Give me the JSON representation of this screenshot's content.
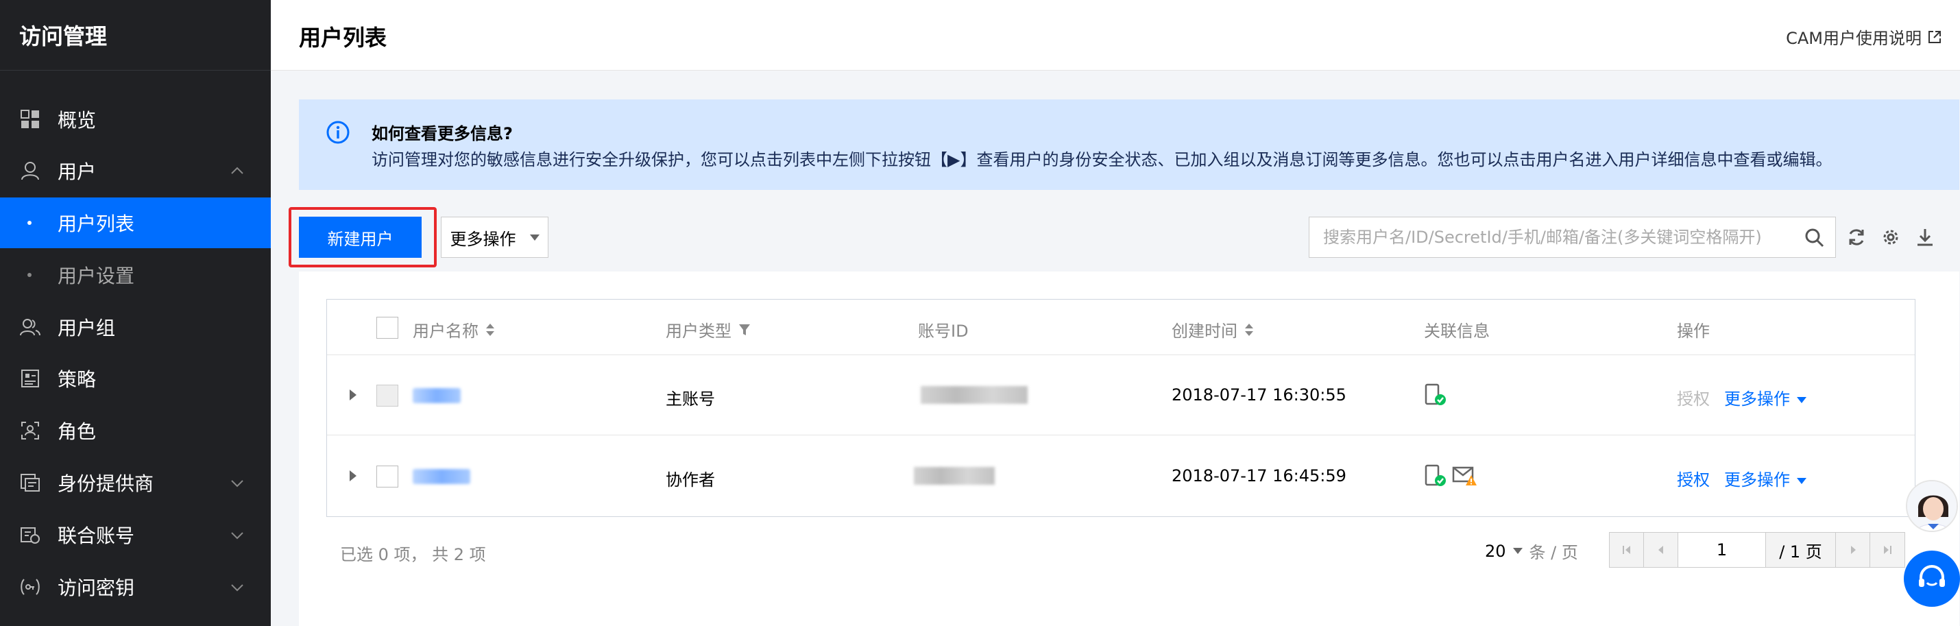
{
  "sidebar": {
    "title": "访问管理",
    "items": [
      {
        "label": "概览",
        "icon": "grid-icon"
      },
      {
        "label": "用户",
        "icon": "user-icon",
        "expanded": true
      },
      {
        "label": "用户列表",
        "active": true
      },
      {
        "label": "用户设置"
      },
      {
        "label": "用户组",
        "icon": "user-group-icon"
      },
      {
        "label": "策略",
        "icon": "policy-icon"
      },
      {
        "label": "角色",
        "icon": "role-icon"
      },
      {
        "label": "身份提供商",
        "icon": "identity-provider-icon"
      },
      {
        "label": "联合账号",
        "icon": "federated-account-icon"
      },
      {
        "label": "访问密钥",
        "icon": "access-key-icon"
      }
    ]
  },
  "header": {
    "title": "用户列表",
    "doc_link": "CAM用户使用说明"
  },
  "banner": {
    "title": "如何查看更多信息?",
    "text": "访问管理对您的敏感信息进行安全升级保护，您可以点击列表中左侧下拉按钮【▶】查看用户的身份安全状态、已加入组以及消息订阅等更多信息。您也可以点击用户名进入用户详细信息中查看或编辑。"
  },
  "toolbar": {
    "new_user": "新建用户",
    "more_actions": "更多操作",
    "search_placeholder": "搜索用户名/ID/SecretId/手机/邮箱/备注(多关键词空格隔开)"
  },
  "table": {
    "columns": [
      "用户名称",
      "用户类型",
      "账号ID",
      "创建时间",
      "关联信息",
      "操作"
    ],
    "rows": [
      {
        "type": "主账号",
        "created": "2018-07-17 16:30:55",
        "authorize": "授权",
        "more": "更多操作",
        "authorize_enabled": false
      },
      {
        "type": "协作者",
        "created": "2018-07-17 16:45:59",
        "authorize": "授权",
        "more": "更多操作",
        "authorize_enabled": true
      }
    ]
  },
  "footer": {
    "selected": "已选 0 项， 共 2 项",
    "page_size": "20",
    "per_page_unit": "条 / 页",
    "current_page": "1",
    "total_pages": "/ 1 页"
  },
  "colors": {
    "primary": "#006eff",
    "sidebar_bg": "#202124",
    "banner_bg": "#d5e7ff",
    "highlight": "#e8282b"
  }
}
